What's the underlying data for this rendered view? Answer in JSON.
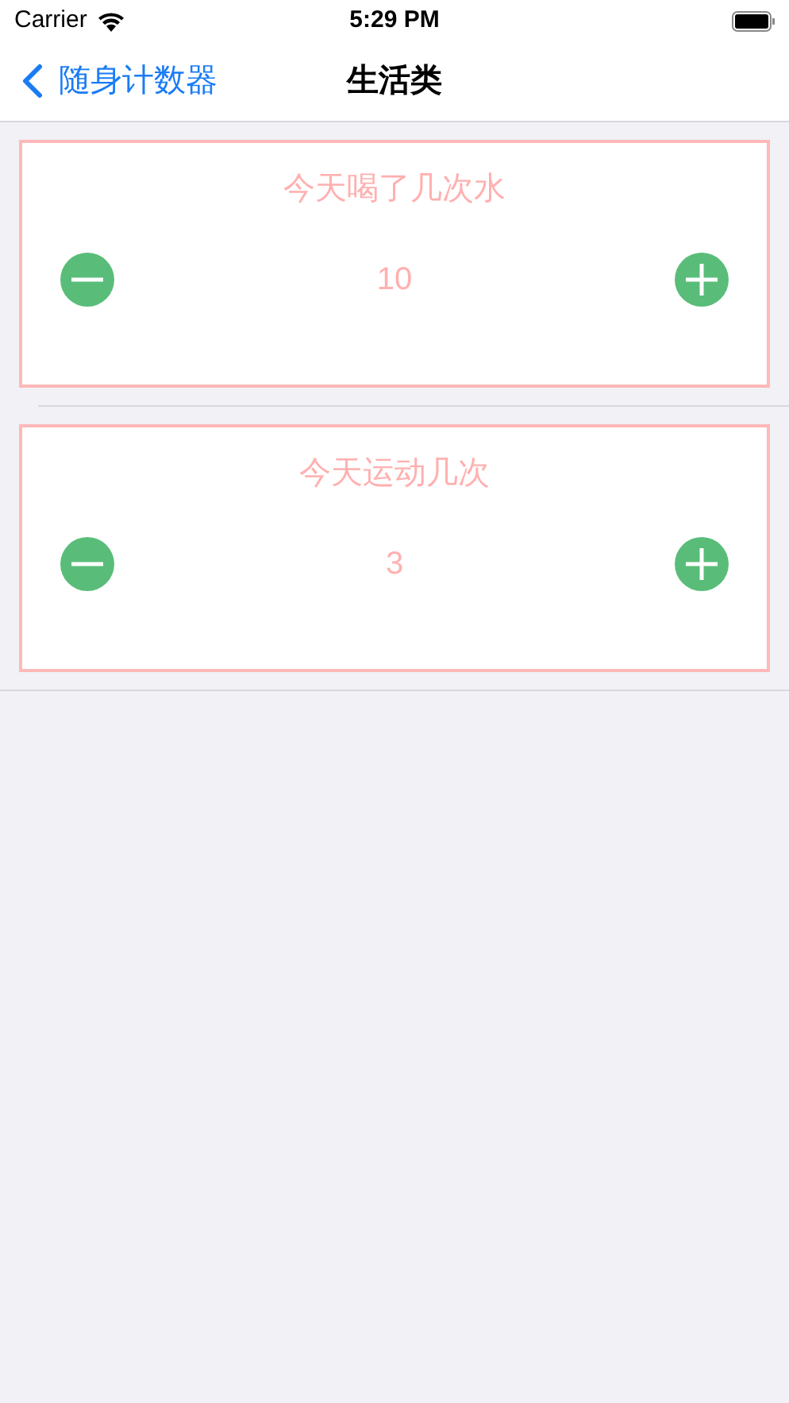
{
  "status_bar": {
    "carrier": "Carrier",
    "time": "5:29 PM"
  },
  "nav": {
    "back_label": "随身计数器",
    "title": "生活类"
  },
  "counters": [
    {
      "title": "今天喝了几次水",
      "value": "10"
    },
    {
      "title": "今天运动几次",
      "value": "3"
    }
  ]
}
